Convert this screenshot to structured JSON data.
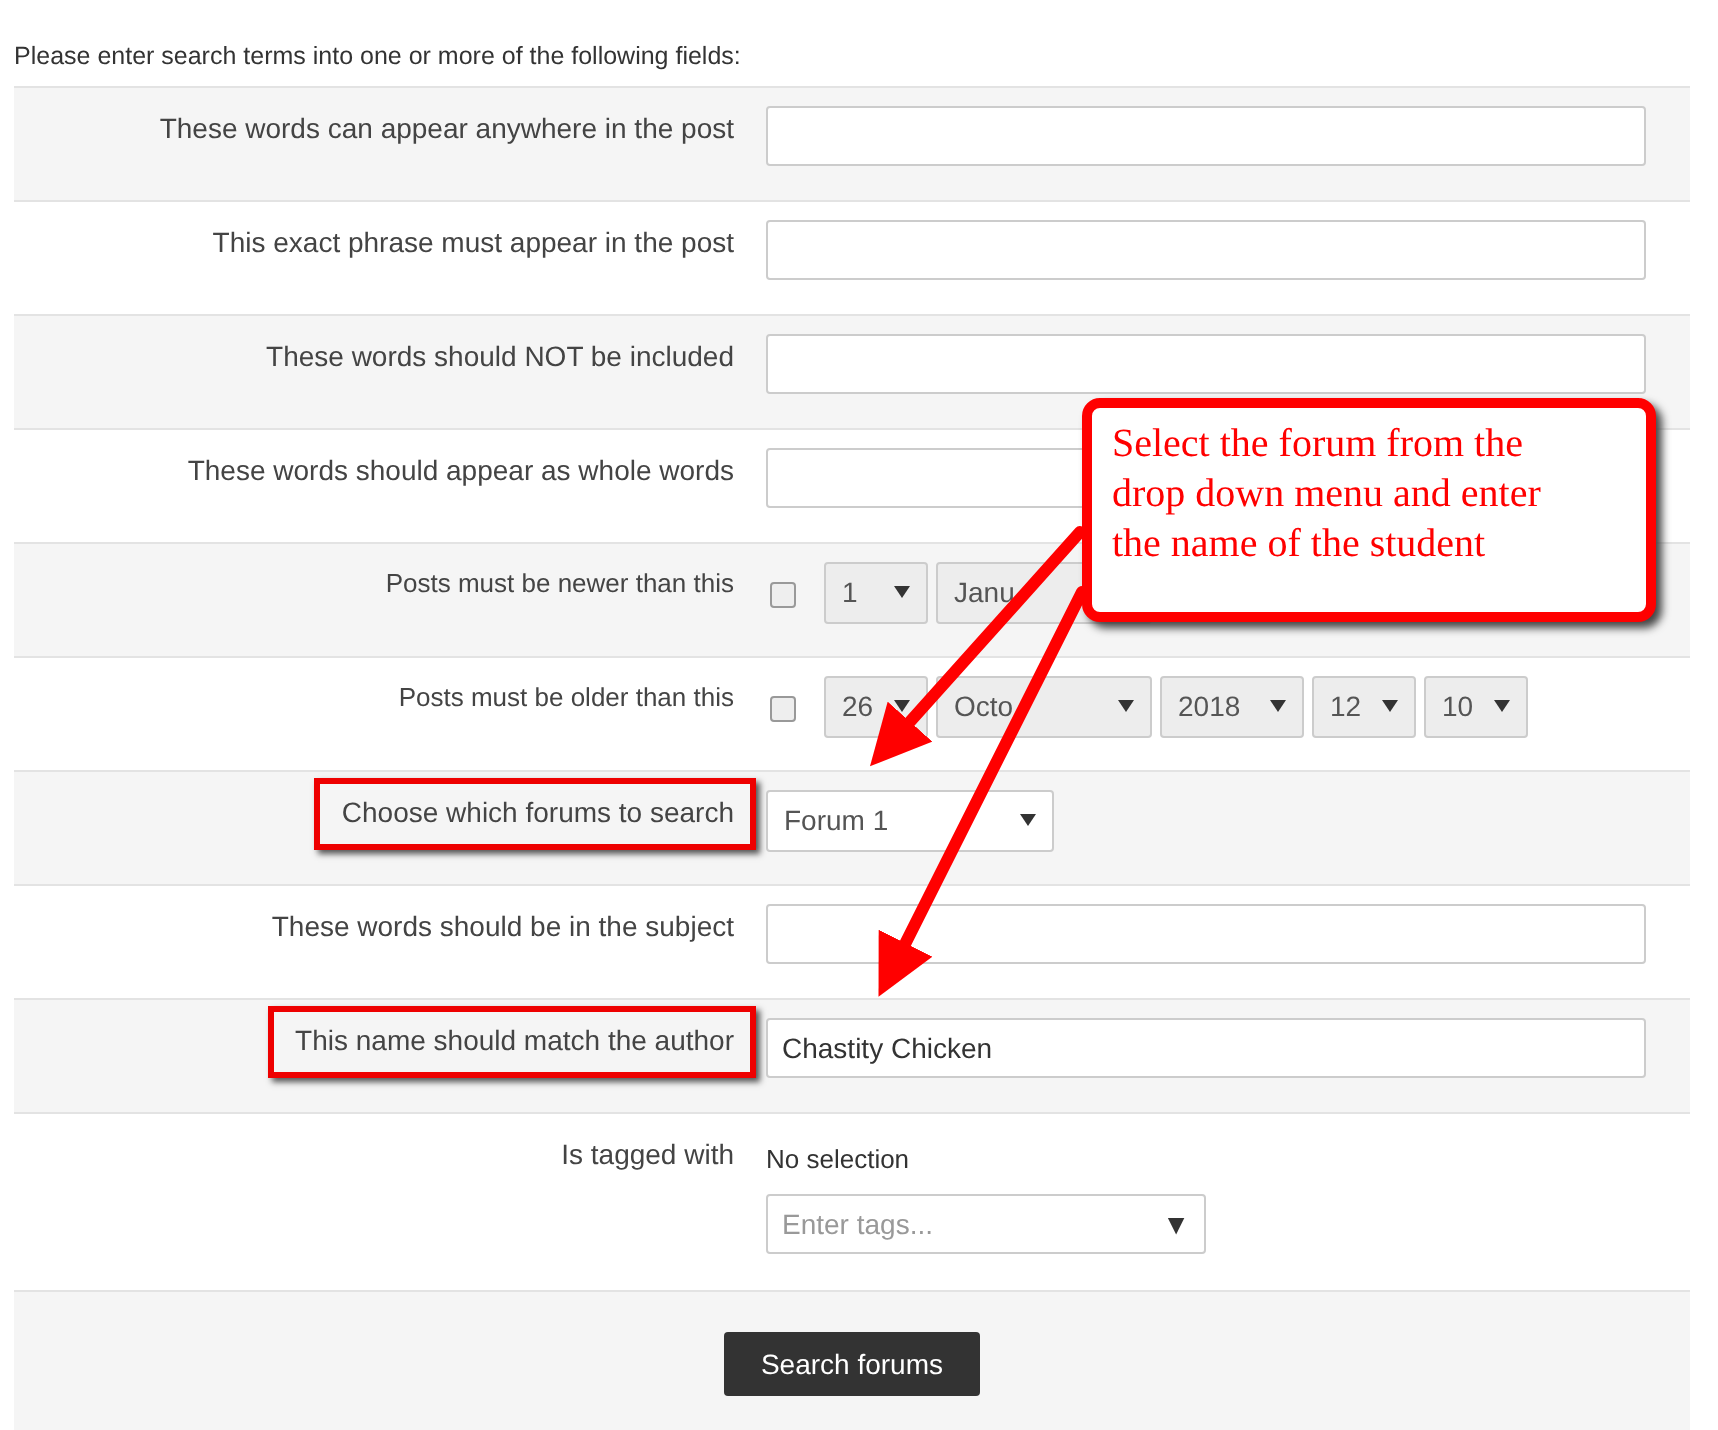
{
  "intro": "Please enter search terms into one or more of the following fields:",
  "fields": [
    {
      "kind": "text",
      "label": "These words can appear anywhere in the post",
      "highlighted": false
    },
    {
      "kind": "text",
      "label": "This exact phrase must appear in the post",
      "highlighted": false
    },
    {
      "kind": "text",
      "label": "These words should NOT be included",
      "highlighted": false
    },
    {
      "kind": "text",
      "label": "These words should appear as whole words",
      "highlighted": false
    },
    {
      "kind": "date",
      "label": "Posts must be newer than this",
      "highlighted": false,
      "checked": false,
      "selects": [
        "1",
        "Janu"
      ]
    },
    {
      "kind": "date",
      "label": "Posts must be older than this",
      "highlighted": false,
      "checked": false,
      "selects": [
        "26",
        "Octo",
        "2018",
        "12",
        "10"
      ]
    },
    {
      "kind": "select",
      "label": "Choose which forums to search",
      "highlighted": true,
      "value": "Forum 1"
    },
    {
      "kind": "text",
      "label": "These words should be in the subject",
      "highlighted": false
    },
    {
      "kind": "text",
      "label": "This name should match the author",
      "highlighted": true,
      "value": "Chastity Chicken"
    },
    {
      "kind": "tags",
      "label": "Is tagged with",
      "highlighted": false,
      "note": "No selection",
      "placeholder": "Enter tags...",
      "caret": "▼"
    }
  ],
  "submit": "Search forums",
  "callout": "Select the forum from the drop down menu and enter the name of the student"
}
